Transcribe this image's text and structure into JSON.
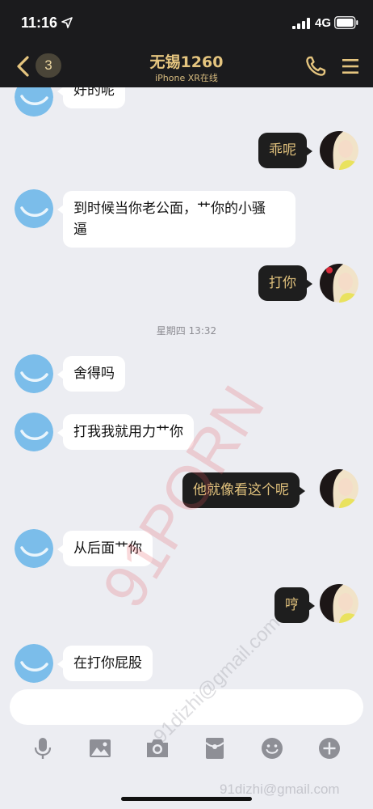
{
  "status_bar": {
    "time": "11:16",
    "network": "4G",
    "icons": [
      "location-arrow-icon",
      "signal-bars-icon",
      "battery-icon"
    ]
  },
  "nav": {
    "back_badge": "3",
    "title": "无锡1260",
    "subtitle": "iPhone XR在线",
    "icons": [
      "back-chevron-icon",
      "phone-icon",
      "menu-icon"
    ],
    "accent_color": "#e5c57f"
  },
  "messages": [
    {
      "side": "in",
      "text": "好的呢"
    },
    {
      "side": "out",
      "text": "乖呢"
    },
    {
      "side": "in",
      "text": "到时候当你老公面，艹你的小骚\n逼"
    },
    {
      "side": "out",
      "text": "打你"
    },
    {
      "timestamp": "星期四 13:32"
    },
    {
      "side": "in",
      "text": "舍得吗"
    },
    {
      "side": "in",
      "text": "打我我就用力艹你"
    },
    {
      "side": "out",
      "text": "他就像看这个呢"
    },
    {
      "side": "in",
      "text": "从后面艹你"
    },
    {
      "side": "out",
      "text": "哼"
    },
    {
      "side": "in",
      "text": "在打你屁股"
    }
  ],
  "composer": {
    "value": "",
    "placeholder": ""
  },
  "toolbar": {
    "icons": [
      "microphone-icon",
      "image-icon",
      "camera-icon",
      "red-packet-icon",
      "emoji-icon",
      "plus-icon"
    ]
  },
  "watermark": {
    "big": "91PORN",
    "email": "91dizhi@gmail.com",
    "email_bottom": "91dizhi@gmail.com"
  },
  "colors": {
    "header_bg": "#1b1b1d",
    "outgoing_bubble": "#1e1e1e",
    "outgoing_text": "#e0c17c",
    "incoming_bubble": "#ffffff",
    "chat_bg": "#ecedf2"
  }
}
